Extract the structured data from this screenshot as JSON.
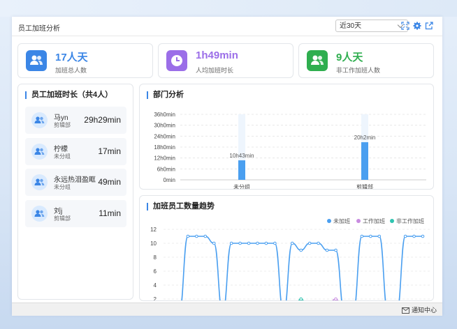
{
  "app": {
    "title": "员工加班分析"
  },
  "header": {
    "range_value": "近30天"
  },
  "kpis": [
    {
      "value": "17人天",
      "label": "加班总人数",
      "color": "#3b86e6"
    },
    {
      "value": "1h49min",
      "label": "人均加班时长",
      "color": "#9b6ee8"
    },
    {
      "value": "9人天",
      "label": "非工作加班人数",
      "color": "#2fae4f"
    }
  ],
  "employees": {
    "title": "员工加班时长（共4人）",
    "items": [
      {
        "name": "马yn",
        "dept": "剪辑部",
        "time": "29h29min"
      },
      {
        "name": "柠檬",
        "dept": "未分组",
        "time": "17min"
      },
      {
        "name": "永远热泪盈眶",
        "dept": "未分组",
        "time": "49min"
      },
      {
        "name": "刘j",
        "dept": "剪辑部",
        "time": "11min"
      }
    ]
  },
  "dept_chart": {
    "title": "部门分析"
  },
  "trend_chart": {
    "title": "加班员工数量趋势"
  },
  "footer": {
    "notice": "通知中心"
  },
  "chart_data": [
    {
      "type": "bar",
      "title": "部门分析",
      "categories": [
        "未分组",
        "剪辑部"
      ],
      "values_minutes": [
        643,
        1240
      ],
      "data_labels": [
        "10h43min",
        "20h2min"
      ],
      "ytick_labels": [
        "0min",
        "6h0min",
        "12h0min",
        "18h0min",
        "24h0min",
        "30h0min",
        "36h0min"
      ],
      "ylim_minutes": [
        0,
        2160
      ],
      "grid": true
    },
    {
      "type": "line",
      "title": "加班员工数量趋势",
      "ylim": [
        0,
        12
      ],
      "yticks": [
        2,
        4,
        6,
        8,
        10,
        12
      ],
      "legend_position": "top-right",
      "series": [
        {
          "name": "未加班",
          "color": "#4a9ff0",
          "values": [
            0,
            0,
            11,
            11,
            11,
            10,
            0,
            10,
            10,
            10,
            10,
            10,
            10,
            0,
            10,
            9,
            10,
            10,
            9,
            9,
            0,
            0,
            11,
            11,
            11,
            0,
            0,
            11,
            11,
            11
          ]
        },
        {
          "name": "工作加班",
          "color": "#c88ce0",
          "values": [
            0,
            0,
            0,
            0,
            0,
            0,
            0,
            1,
            1,
            0,
            1,
            0,
            0,
            0,
            1,
            1,
            1,
            0,
            1,
            2,
            0,
            0,
            0,
            0,
            0,
            0,
            0,
            0,
            0,
            0
          ]
        },
        {
          "name": "非工作加班",
          "color": "#2ec4b0",
          "values": [
            0,
            0,
            0,
            0,
            0,
            1,
            0,
            0,
            0,
            1,
            0,
            1,
            1,
            0,
            0,
            2,
            0,
            1,
            0,
            1,
            0,
            0,
            0,
            0,
            0,
            0,
            0,
            0,
            0,
            0
          ]
        }
      ]
    }
  ]
}
